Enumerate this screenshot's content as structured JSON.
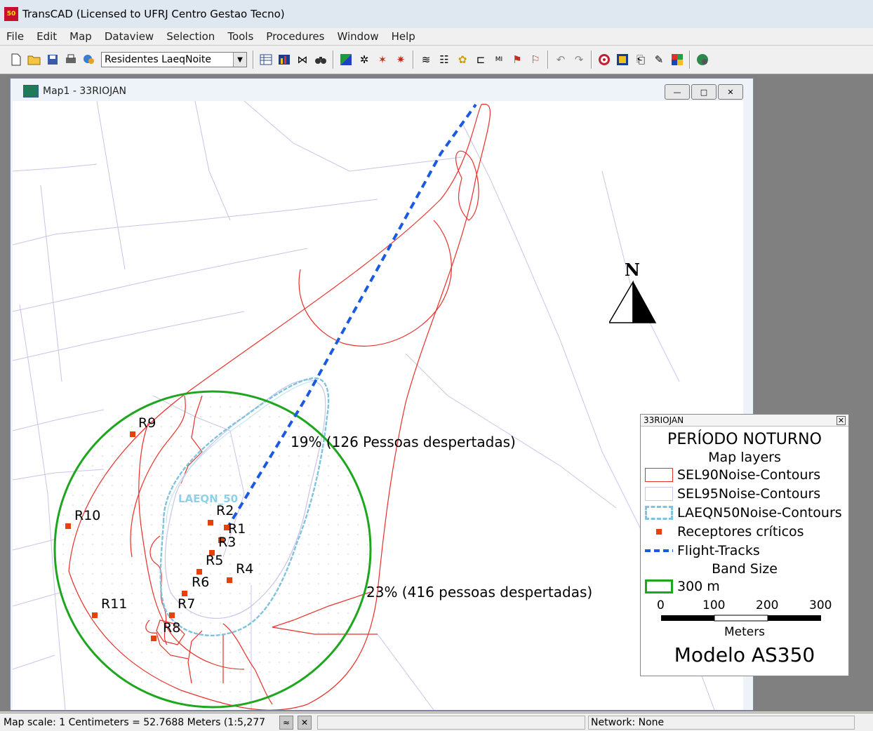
{
  "app": {
    "title": "TransCAD (Licensed to UFRJ Centro Gestao Tecno)",
    "icon_text": "50"
  },
  "menu": [
    "File",
    "Edit",
    "Map",
    "Dataview",
    "Selection",
    "Tools",
    "Procedures",
    "Window",
    "Help"
  ],
  "toolbar": {
    "layer_value": "Residentes LaeqNoite"
  },
  "map_window": {
    "title": "Map1 - 33RIOJAN"
  },
  "map": {
    "receptors": [
      {
        "name": "R9"
      },
      {
        "name": "R10"
      },
      {
        "name": "R2"
      },
      {
        "name": "R1"
      },
      {
        "name": "R3"
      },
      {
        "name": "R5"
      },
      {
        "name": "R4"
      },
      {
        "name": "R6"
      },
      {
        "name": "R7"
      },
      {
        "name": "R11"
      },
      {
        "name": "R8"
      }
    ],
    "laeq_label": "LAEQN_50",
    "annotation_1": "19% (126 Pessoas despertadas)",
    "annotation_2": "23% (416 pessoas despertadas)",
    "north_label": "N",
    "colors": {
      "sel90": "#e8302a",
      "sel95": "#c9c4e8",
      "laeq": "#7fc3dd",
      "receptor": "#e8400a",
      "flight": "#1a5ae0",
      "band": "#1fa61f"
    }
  },
  "legend": {
    "header": "33RIOJAN",
    "title": "PERÍODO NOTURNO",
    "subtitle": "Map layers",
    "items": [
      {
        "label": "SEL90Noise-Contours"
      },
      {
        "label": "SEL95Noise-Contours"
      },
      {
        "label": "LAEQN50Noise-Contours"
      },
      {
        "label": "Receptores críticos"
      },
      {
        "label": "Flight-Tracks"
      }
    ],
    "band_title": "Band Size",
    "band_label": "300 m",
    "scale_ticks": [
      "0",
      "100",
      "200",
      "300"
    ],
    "scale_unit": "Meters",
    "model": "Modelo AS350"
  },
  "status": {
    "scale": "Map scale: 1 Centimeters = 52.7688 Meters (1:5,277",
    "network": "Network: None"
  }
}
